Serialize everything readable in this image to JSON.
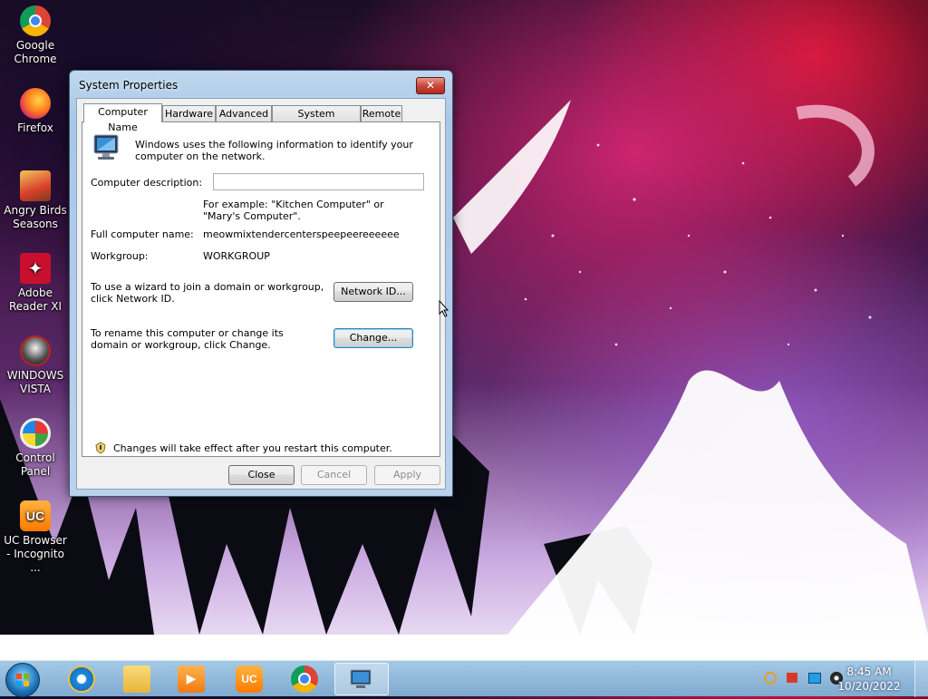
{
  "desktop": {
    "icons": [
      {
        "label": "Google Chrome",
        "icon": "chrome-icon"
      },
      {
        "label": "Firefox",
        "icon": "firefox-icon"
      },
      {
        "label": "Angry Birds Seasons",
        "icon": "angry-birds-icon"
      },
      {
        "label": "Adobe Reader XI",
        "icon": "adobe-reader-icon"
      },
      {
        "label": "WINDOWS VISTA",
        "icon": "windows-vista-icon"
      },
      {
        "label": "Control Panel",
        "icon": "control-panel-icon"
      },
      {
        "label": "UC Browser - Incognito ...",
        "icon": "uc-browser-icon"
      }
    ]
  },
  "dialog": {
    "title": "System Properties",
    "close_glyph": "✕",
    "tabs": [
      "Computer Name",
      "Hardware",
      "Advanced",
      "System Protection",
      "Remote"
    ],
    "active_tab": "Computer Name",
    "intro": "Windows uses the following information to identify your computer on the network.",
    "description_label": "Computer description:",
    "description_value": "",
    "example": "For example: \"Kitchen Computer\" or \"Mary's Computer\".",
    "full_name_label": "Full computer name:",
    "full_name_value": "meowmixtendercenterspeepeereeeeee",
    "workgroup_label": "Workgroup:",
    "workgroup_value": "WORKGROUP",
    "wizard_text": "To use a wizard to join a domain or workgroup, click Network ID.",
    "network_id_button": "Network ID...",
    "rename_text": "To rename this computer or change its domain or workgroup, click Change.",
    "change_button": "Change...",
    "restart_note": "Changes will take effect after you restart this computer.",
    "close_button": "Close",
    "cancel_button": "Cancel",
    "apply_button": "Apply"
  },
  "taskbar": {
    "clock_time": "8:45 AM",
    "clock_date": "10/20/2022"
  }
}
